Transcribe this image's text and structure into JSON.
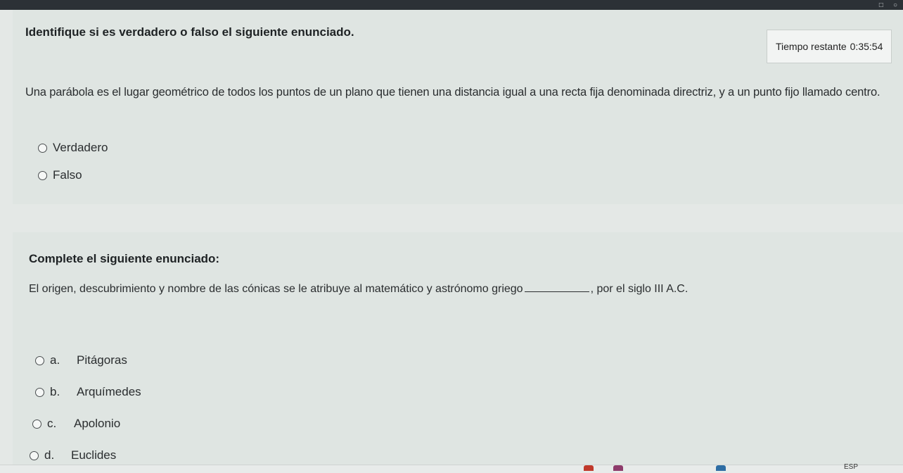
{
  "question1": {
    "title": "Identifique si es verdadero o falso el siguiente enunciado.",
    "text": "Una parábola es el lugar geométrico de todos los puntos de un plano que tienen una distancia igual a una recta fija denominada directriz, y a un punto fijo llamado centro.",
    "options": [
      {
        "label": "Verdadero"
      },
      {
        "label": "Falso"
      }
    ]
  },
  "timer": {
    "label": "Tiempo restante",
    "value": "0:35:54"
  },
  "question2": {
    "title": "Complete el siguiente enunciado:",
    "text_before": "El origen, descubrimiento y nombre de las cónicas se le atribuye al matemático y astrónomo griego",
    "text_after": ", por el siglo III A.C.",
    "options": [
      {
        "letter": "a.",
        "label": "Pitágoras"
      },
      {
        "letter": "b.",
        "label": "Arquímedes"
      },
      {
        "letter": "c.",
        "label": "Apolonio"
      },
      {
        "letter": "d.",
        "label": "Euclides"
      }
    ]
  },
  "taskbar": {
    "language": "ESP"
  },
  "colors": {
    "background": "#e4e8e6",
    "card": "#dfe5e2",
    "text": "#26292b",
    "topbar": "#2c3136"
  }
}
